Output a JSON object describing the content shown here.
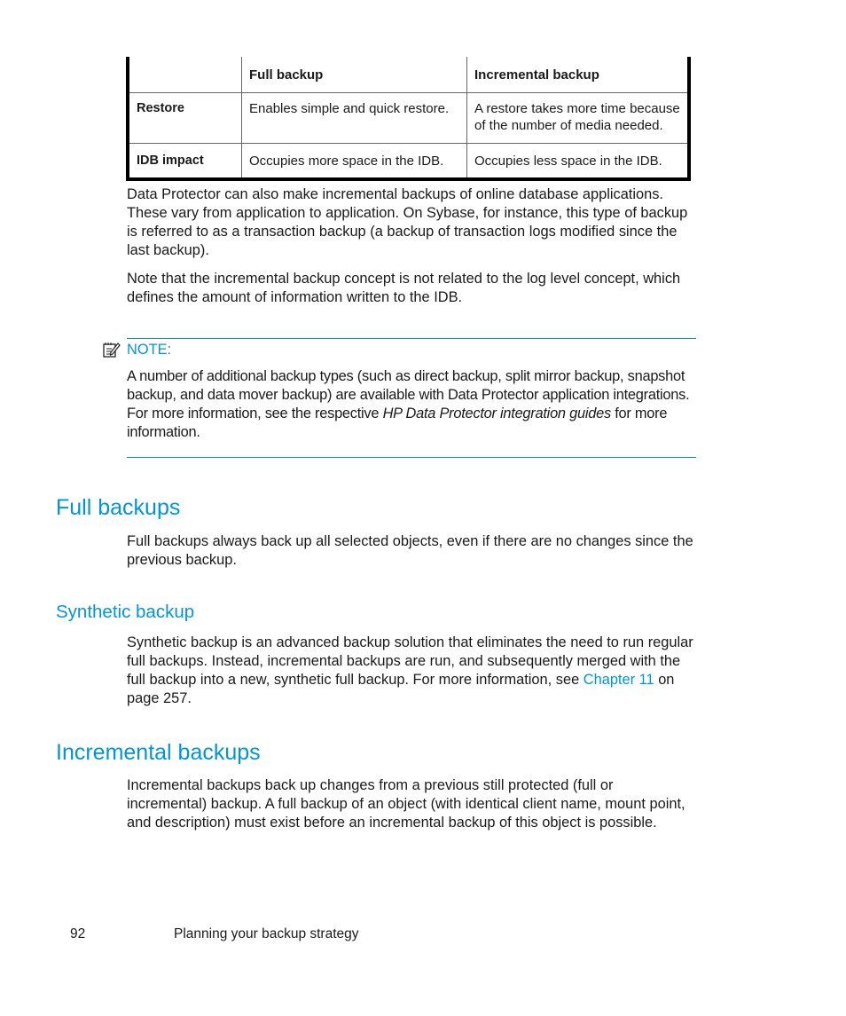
{
  "table": {
    "headers": [
      "",
      "Full backup",
      "Incremental backup"
    ],
    "rows": [
      {
        "label": "Restore",
        "full": "Enables simple and quick restore.",
        "incremental": "A restore takes more time because of the number of media needed."
      },
      {
        "label": "IDB impact",
        "full": "Occupies more space in the IDB.",
        "incremental": "Occupies less space in the IDB."
      }
    ]
  },
  "paragraphs": {
    "p1": "Data Protector can also make incremental backups of online database applications. These vary from application to application. On Sybase, for instance, this type of backup is referred to as a transaction backup (a backup of transaction logs modified since the last backup).",
    "p2": "Note that the incremental backup concept is not related to the log level concept, which defines the amount of information written to the IDB."
  },
  "note": {
    "icon": "note-pencil-icon",
    "label": "NOTE:",
    "text_before": "A number of additional backup types (such as direct backup, split mirror backup, snapshot backup, and data mover backup) are available with Data Protector application integrations. For more information, see the respective ",
    "text_italic": "HP Data Protector integration guides",
    "text_after": " for more information."
  },
  "sections": {
    "full": {
      "heading": "Full backups",
      "text": "Full backups always back up all selected objects, even if there are no changes since the previous backup."
    },
    "synthetic": {
      "heading": "Synthetic backup",
      "text_before": "Synthetic backup is an advanced backup solution that eliminates the need to run regular full backups. Instead, incremental backups are run, and subsequently merged with the full backup into a new, synthetic full backup. For more information, see ",
      "link": "Chapter 11",
      "text_after": " on page 257."
    },
    "incremental": {
      "heading": "Incremental backups",
      "text": "Incremental backups back up changes from a previous still protected (full or incremental) backup. A full backup of an object (with identical client name, mount point, and description) must exist before an incremental backup of this object is possible."
    }
  },
  "footer": {
    "page_number": "92",
    "chapter_title": "Planning your backup strategy"
  }
}
